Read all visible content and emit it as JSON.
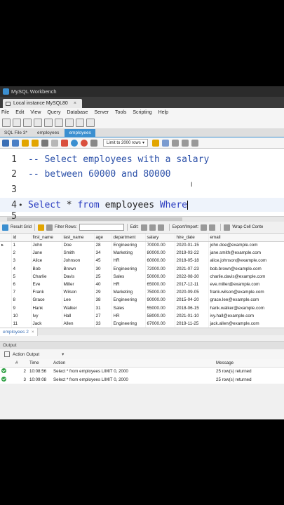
{
  "window": {
    "title": "MySQL Workbench"
  },
  "instance_tab": {
    "label": "Local instance MySQL80",
    "close": "×"
  },
  "menu": [
    "File",
    "Edit",
    "View",
    "Query",
    "Database",
    "Server",
    "Tools",
    "Scripting",
    "Help"
  ],
  "sql_tabs": [
    {
      "label": "SQL File 3*",
      "active": false
    },
    {
      "label": "employees",
      "active": false
    },
    {
      "label": "employees",
      "active": true
    }
  ],
  "editor_toolbar": {
    "limit_label": "Limit to 2000 rows",
    "limit_arrow": "▾"
  },
  "editor": {
    "lines": [
      {
        "n": "1",
        "text": "-- Select employees with a salary"
      },
      {
        "n": "2",
        "text": "-- between 60000 and 80000"
      },
      {
        "n": "3",
        "text": ""
      },
      {
        "n": "4",
        "kw1": "Select",
        "op": " * ",
        "kw2": "from",
        "tbl": " employees ",
        "kw3": "Where"
      },
      {
        "n": "5",
        "text": ""
      }
    ],
    "line_marker": "•",
    "mouse_cursor": "I"
  },
  "result_toolbar": {
    "result_grid": "Result Grid",
    "filter_rows": "Filter Rows:",
    "edit": "Edit:",
    "export": "Export/Import:",
    "wrap": "Wrap Cell Conte"
  },
  "grid": {
    "columns": [
      "",
      "id",
      "first_name",
      "last_name",
      "age",
      "department",
      "salary",
      "hire_date",
      "email"
    ],
    "rows": [
      [
        "▸",
        "1",
        "John",
        "Doe",
        "28",
        "Engineering",
        "70000.00",
        "2020-01-15",
        "john.doe@example.com"
      ],
      [
        "",
        "2",
        "Jane",
        "Smith",
        "34",
        "Marketing",
        "80000.00",
        "2019-03-22",
        "jane.smith@example.com"
      ],
      [
        "",
        "3",
        "Alice",
        "Johnson",
        "45",
        "HR",
        "60000.00",
        "2018-05-18",
        "alice.johnson@example.com"
      ],
      [
        "",
        "4",
        "Bob",
        "Brown",
        "30",
        "Engineering",
        "72000.00",
        "2021-07-23",
        "bob.brown@example.com"
      ],
      [
        "",
        "5",
        "Charlie",
        "Davis",
        "25",
        "Sales",
        "50000.00",
        "2022-08-30",
        "charlie.davis@example.com"
      ],
      [
        "",
        "6",
        "Eve",
        "Miller",
        "40",
        "HR",
        "65000.00",
        "2017-12-11",
        "eve.miller@example.com"
      ],
      [
        "",
        "7",
        "Frank",
        "Wilson",
        "29",
        "Marketing",
        "75000.00",
        "2020-09-05",
        "frank.wilson@example.com"
      ],
      [
        "",
        "8",
        "Grace",
        "Lee",
        "38",
        "Engineering",
        "90000.00",
        "2015-04-20",
        "grace.lee@example.com"
      ],
      [
        "",
        "9",
        "Hank",
        "Walker",
        "31",
        "Sales",
        "55000.00",
        "2018-06-15",
        "hank.walker@example.com"
      ],
      [
        "",
        "10",
        "Ivy",
        "Hall",
        "27",
        "HR",
        "58000.00",
        "2021-01-10",
        "ivy.hall@example.com"
      ],
      [
        "",
        "11",
        "Jack",
        "Allen",
        "33",
        "Engineering",
        "67000.00",
        "2019-11-25",
        "jack.allen@example.com"
      ]
    ]
  },
  "result_tabs": [
    {
      "label": "employees 2",
      "close": "×"
    }
  ],
  "output": {
    "header": "Output",
    "selector": "Action Output",
    "selector_arrow": "▾",
    "columns": [
      "",
      "#",
      "Time",
      "Action",
      "Message"
    ],
    "rows": [
      {
        "n": "2",
        "time": "10:08:56",
        "action": "Select * from employees LIMIT 0, 2000",
        "message": "25 row(s) returned"
      },
      {
        "n": "3",
        "time": "10:09:08",
        "action": "Select * from employees LIMIT 0, 2000",
        "message": "25 row(s) returned"
      }
    ]
  },
  "colors": {
    "accent": "#3b8fd0",
    "ok": "#2ea043",
    "keyword": "#2a3cc0",
    "comment": "#2a4fa8"
  }
}
